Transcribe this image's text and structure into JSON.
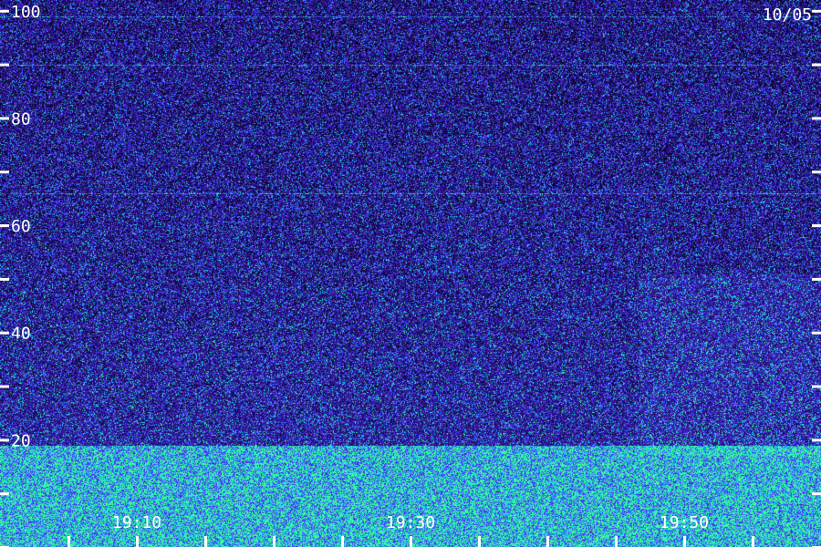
{
  "date_label": "10/05",
  "chart_data": {
    "type": "heatmap",
    "title": "",
    "xlabel": "",
    "ylabel": "",
    "ylim": [
      0,
      102
    ],
    "y_tick_labels": [
      "20",
      "40",
      "60",
      "80",
      "100"
    ],
    "y_ticks_labeled": [
      20,
      40,
      60,
      80,
      100
    ],
    "y_ticks_minor": [
      0,
      10,
      30,
      50,
      70,
      90
    ],
    "x_tick_labels": [
      "19:10",
      "19:30",
      "19:50"
    ],
    "x_tick_count": 12,
    "colors": {
      "background": "#14083a",
      "low": "#3a1ab0",
      "mid": "#4a3cff",
      "high": "#1ec8e6",
      "peak": "#38ff9a",
      "text": "#ffffff"
    },
    "horizontal_lines_at": [
      99,
      90,
      66
    ],
    "high_energy_band": [
      0,
      19
    ]
  }
}
